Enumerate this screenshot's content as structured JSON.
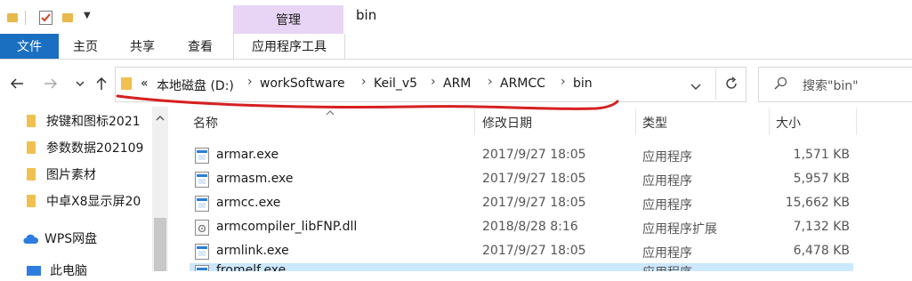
{
  "window": {
    "title": "bin",
    "manage_tab": "管理",
    "app_tools_tab": "应用程序工具"
  },
  "ribbon": {
    "file_tab": "文件",
    "tabs": [
      "主页",
      "共享",
      "查看"
    ]
  },
  "nav": {
    "back_icon": "arrow-left-icon",
    "forward_icon": "arrow-right-icon",
    "recent_icon": "chevron-down-icon",
    "up_icon": "arrow-up-icon"
  },
  "address": {
    "overflow": "«",
    "crumbs": [
      "本地磁盘 (D:)",
      "workSoftware",
      "Keil_v5",
      "ARM",
      "ARMCC",
      "bin"
    ],
    "annotation_color": "#d62020"
  },
  "search": {
    "placeholder": "搜索\"bin\""
  },
  "sidebar": {
    "items": [
      {
        "label": "按键和图标2021",
        "icon": "folder-icon"
      },
      {
        "label": "参数数据202109",
        "icon": "folder-icon"
      },
      {
        "label": "图片素材",
        "icon": "folder-icon"
      },
      {
        "label": "中卓X8显示屏20",
        "icon": "folder-icon"
      },
      {
        "label": "WPS网盘",
        "icon": "cloud-icon"
      },
      {
        "label": "此电脑",
        "icon": "computer-icon"
      }
    ]
  },
  "columns": {
    "name": "名称",
    "modified": "修改日期",
    "type": "类型",
    "size": "大小"
  },
  "files": [
    {
      "name": "armar.exe",
      "modified": "2017/9/27 18:05",
      "type": "应用程序",
      "size": "1,571 KB",
      "icon": "exe-icon"
    },
    {
      "name": "armasm.exe",
      "modified": "2017/9/27 18:05",
      "type": "应用程序",
      "size": "5,957 KB",
      "icon": "exe-icon"
    },
    {
      "name": "armcc.exe",
      "modified": "2017/9/27 18:05",
      "type": "应用程序",
      "size": "15,662 KB",
      "icon": "exe-icon"
    },
    {
      "name": "armcompiler_libFNP.dll",
      "modified": "2018/8/28 8:16",
      "type": "应用程序扩展",
      "size": "7,132 KB",
      "icon": "dll-icon"
    },
    {
      "name": "armlink.exe",
      "modified": "2017/9/27 18:05",
      "type": "应用程序",
      "size": "6,478 KB",
      "icon": "exe-icon"
    },
    {
      "name": "fromelf.exe",
      "modified": "",
      "type": "应用程序",
      "size": "",
      "icon": "exe-icon"
    }
  ]
}
